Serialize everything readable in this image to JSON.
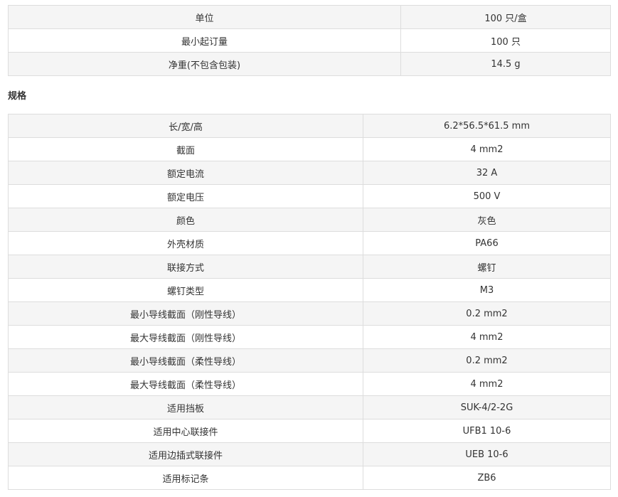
{
  "basic_info": [
    {
      "label": "单位",
      "value": "100 只/盒"
    },
    {
      "label": "最小起订量",
      "value": "100 只"
    },
    {
      "label": "净重(不包含包装)",
      "value": "14.5 g"
    }
  ],
  "specs_heading": "规格",
  "specs": [
    {
      "label": "长/宽/高",
      "value": "6.2*56.5*61.5 mm"
    },
    {
      "label": "截面",
      "value": "4 mm2"
    },
    {
      "label": "额定电流",
      "value": "32 A"
    },
    {
      "label": "额定电压",
      "value": "500 V"
    },
    {
      "label": "颜色",
      "value": "灰色"
    },
    {
      "label": "外壳材质",
      "value": "PA66"
    },
    {
      "label": "联接方式",
      "value": "螺钉"
    },
    {
      "label": "螺钉类型",
      "value": "M3"
    },
    {
      "label": "最小导线截面（刚性导线）",
      "value": "0.2 mm2"
    },
    {
      "label": "最大导线截面（刚性导线）",
      "value": "4 mm2"
    },
    {
      "label": "最小导线截面（柔性导线）",
      "value": "0.2 mm2"
    },
    {
      "label": "最大导线截面（柔性导线）",
      "value": "4 mm2"
    },
    {
      "label": "适用挡板",
      "value": "SUK-4/2-2G"
    },
    {
      "label": "适用中心联接件",
      "value": "UFB1 10-6"
    },
    {
      "label": "适用边插式联接件",
      "value": "UEB 10-6"
    },
    {
      "label": "适用标记条",
      "value": "ZB6"
    }
  ]
}
